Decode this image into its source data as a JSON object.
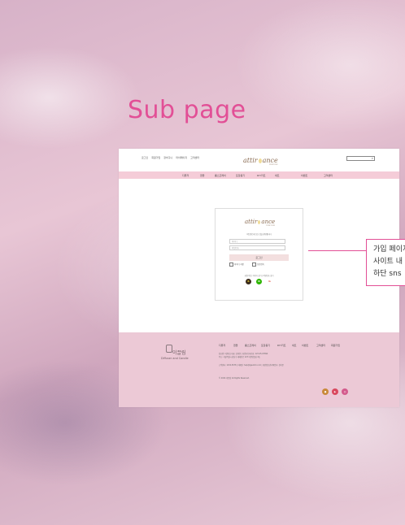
{
  "page": {
    "title": "Sub page"
  },
  "header": {
    "util_links": [
      "로그인",
      "회원가입",
      "장바구니",
      "마이페이지",
      "고객센터"
    ],
    "logo": {
      "text": "attir",
      "text2": "ance",
      "sub": "PERFUME"
    },
    "search": {
      "icon": "search-icon"
    }
  },
  "nav": {
    "items": [
      "디퓨저",
      "캔들",
      "룸스프레이",
      "포장용기",
      "DIY키트",
      "세트",
      "이벤트",
      "고객센터"
    ]
  },
  "login": {
    "logo": {
      "text": "attir",
      "text2": "ance",
      "sub": "PERFUME"
    },
    "welcome": "어트랜스에 오신 것을 환영합니다",
    "id_placeholder": "아이디",
    "pw_placeholder": "비밀번호",
    "button": "로그인",
    "save_id": "아이디 저장",
    "secure": "보안접속",
    "links": "회원가입 | 아이디 찾기 | 비밀번호 찾기",
    "sns": [
      {
        "name": "kakao",
        "label": "K",
        "color": "#3a2a1a",
        "text_color": "#f5dc3a"
      },
      {
        "name": "naver",
        "label": "N",
        "color": "#2db400",
        "text_color": "#ffffff"
      },
      {
        "name": "google",
        "label": "G",
        "color": "#ffffff",
        "text_color": "#e04a3a"
      }
    ]
  },
  "footer": {
    "brand": "이끌림",
    "tagline": "Diffuser and Candle",
    "menu": [
      "디퓨저",
      "캔들",
      "룸스프레이",
      "포장용기",
      "DIY키트",
      "세트",
      "이벤트",
      "고객센터",
      "회원가입"
    ],
    "info_lines": [
      "상호명: 이끌림 | 대표: 김이끌 | 사업자등록번호: 123-45-67890",
      "주소: 서울특별시 강남구 테헤란로 123 이끌림빌딩 4층",
      "고객센터: 1234-5678 | 이메일: help@igeullim.com | 개인정보관리책임자: 김이끌",
      "© 2024 이끌림 All Rights Reserved."
    ],
    "sns": [
      {
        "name": "kakao-story",
        "color": "#c9893a"
      },
      {
        "name": "youtube",
        "color": "#d9485e"
      },
      {
        "name": "instagram",
        "color": "#d45a8c"
      }
    ]
  },
  "callout": {
    "lines": [
      "가입 페이지",
      "사이트 내",
      "하단 sns"
    ]
  },
  "colors": {
    "accent": "#e24f96",
    "nav_bg": "#f5ccd8",
    "footer_bg": "#ecc9d6",
    "button_bg": "#f3dfdf"
  }
}
